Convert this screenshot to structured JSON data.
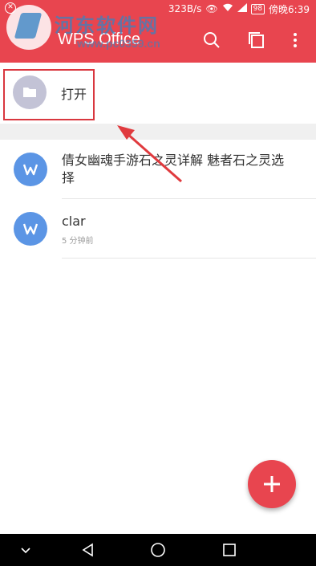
{
  "status_bar": {
    "network_speed": "323B/s",
    "battery": "98",
    "time": "傍晚6:39",
    "icons": [
      "notification-icon",
      "eye-icon",
      "wifi-icon",
      "signal-icon",
      "battery-icon"
    ]
  },
  "watermark": {
    "site_name": "河东软件网",
    "url": "www.pc0359.cn"
  },
  "app_bar": {
    "title": "WPS Office",
    "actions": [
      "search-icon",
      "window-switch-icon",
      "more-icon"
    ]
  },
  "open_row": {
    "label": "打开",
    "icon": "folder-icon"
  },
  "files": [
    {
      "title": "倩女幽魂手游石之灵详解 魅者石之灵选择",
      "time": ""
    },
    {
      "title": "clar",
      "time": "5 分钟前"
    }
  ],
  "fab": {
    "icon": "plus-icon"
  },
  "nav_bar": {
    "buttons": [
      "hide-nav-icon",
      "back-icon",
      "home-icon",
      "recents-icon"
    ]
  },
  "colors": {
    "primary": "#e8454f",
    "file_avatar": "#5b95e5",
    "folder_circle": "#c3c3d6",
    "highlight": "#d9373f"
  }
}
